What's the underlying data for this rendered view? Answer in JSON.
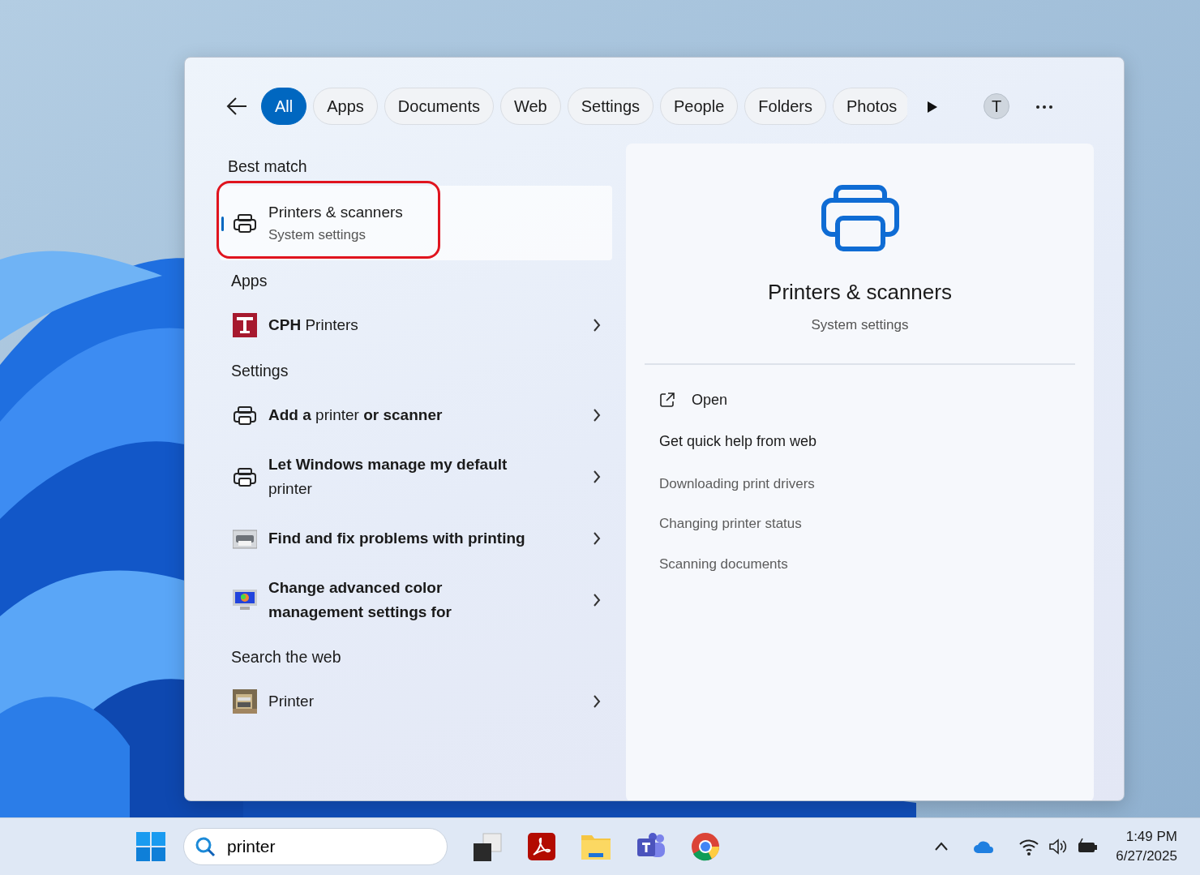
{
  "filters": {
    "tabs": [
      {
        "label": "All",
        "selected": true
      },
      {
        "label": "Apps",
        "selected": false
      },
      {
        "label": "Documents",
        "selected": false
      },
      {
        "label": "Web",
        "selected": false
      },
      {
        "label": "Settings",
        "selected": false
      },
      {
        "label": "People",
        "selected": false
      },
      {
        "label": "Folders",
        "selected": false
      },
      {
        "label": "Photos",
        "selected": false
      }
    ],
    "avatar": "T"
  },
  "results": [
    {
      "heading": "Best match",
      "items": [
        {
          "kind": "best",
          "title": "Printers & scanners",
          "subtitle": "System settings",
          "selected": true,
          "circled": true
        }
      ]
    },
    {
      "heading": "Apps",
      "items": [
        {
          "kind": "app_tile",
          "title": "**CPH** Printers",
          "selected": false,
          "circled": false
        }
      ]
    },
    {
      "heading": "Settings",
      "items": [
        {
          "kind": "printer_glyph",
          "title": "**Add a** printer **or scanner**",
          "selected": false,
          "circled": false
        },
        {
          "kind": "printer_glyph",
          "title": "**Let Windows manage my default** printer",
          "selected": false,
          "circled": false
        },
        {
          "kind": "legacy_printer",
          "title": "**Find and fix problems with printing**",
          "selected": false,
          "circled": false
        },
        {
          "kind": "legacy_monitor",
          "title": "**Change advanced color management settings for**",
          "selected": false,
          "circled": false
        }
      ]
    },
    {
      "heading": "Search the web",
      "items": [
        {
          "kind": "web_picture",
          "title": "Printer",
          "selected": false,
          "circled": false
        }
      ]
    }
  ],
  "preview": {
    "title": "Printers & scanners",
    "subtitle": "System settings",
    "actions": [
      {
        "label": "Open"
      }
    ],
    "help_heading": "Get quick help from web",
    "help_links": [
      "Downloading print drivers",
      "Changing printer status",
      "Scanning documents"
    ]
  },
  "taskbar": {
    "search_value": "printer",
    "time": "1:49 PM",
    "date": "6/27/2025"
  }
}
